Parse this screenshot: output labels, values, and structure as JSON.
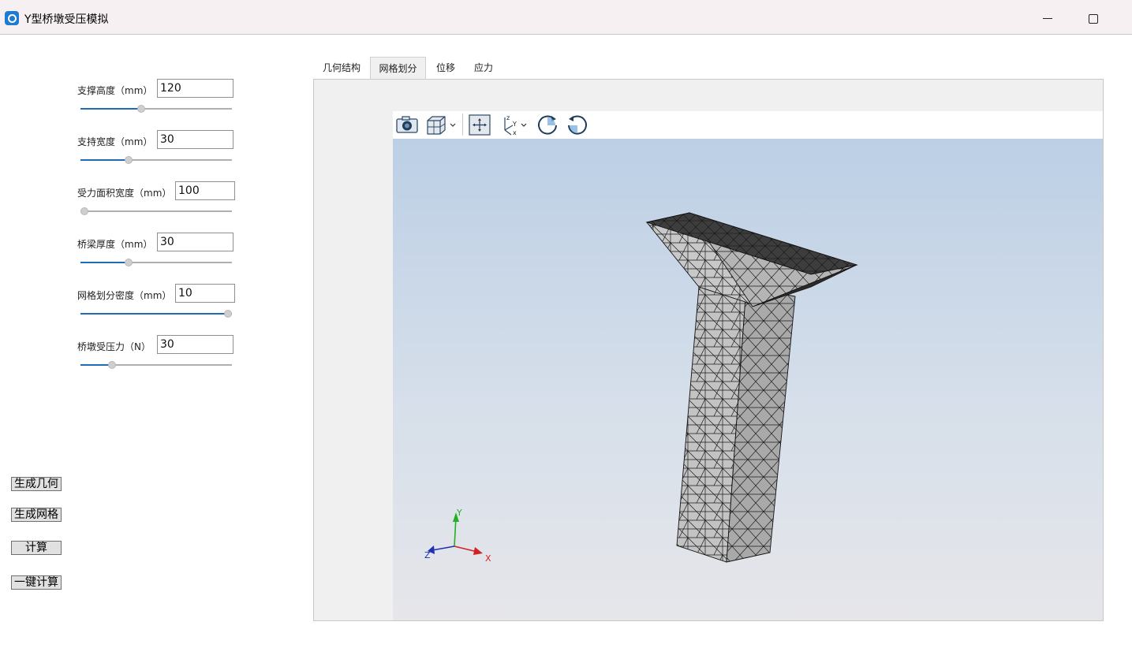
{
  "window": {
    "title": "Y型桥墩受压模拟"
  },
  "params": [
    {
      "label": "支撑高度（mm）",
      "value": "120",
      "slider": 0.4
    },
    {
      "label": "支持宽度（mm）",
      "value": "30",
      "slider": 0.32
    },
    {
      "label": "受力面积宽度（mm）",
      "value": "100",
      "slider": 0.0
    },
    {
      "label": "桥梁厚度（mm）",
      "value": "30",
      "slider": 0.32
    },
    {
      "label": "网格划分密度（mm）",
      "value": "10",
      "slider": 1.0
    },
    {
      "label": "桥墩受压力（N）",
      "value": "30",
      "slider": 0.21
    }
  ],
  "buttons": {
    "gen_geometry": "生成几何",
    "gen_mesh": "生成网格",
    "compute": "计算",
    "one_click": "一键计算"
  },
  "tabs": [
    "几何结构",
    "网格划分",
    "位移",
    "应力"
  ],
  "active_tab": "网格划分",
  "toolbar_icons": [
    "camera-icon",
    "display-mode-icon",
    "fit-view-icon",
    "axes-orientation-icon",
    "rotate-cw-icon",
    "rotate-ccw-icon"
  ],
  "axes": {
    "x": "X",
    "y": "Y",
    "z": "Z"
  },
  "colors": {
    "accent": "#1e6bb8",
    "mesh_face": "#b8b8b8",
    "mesh_top": "#3a3a3a"
  }
}
